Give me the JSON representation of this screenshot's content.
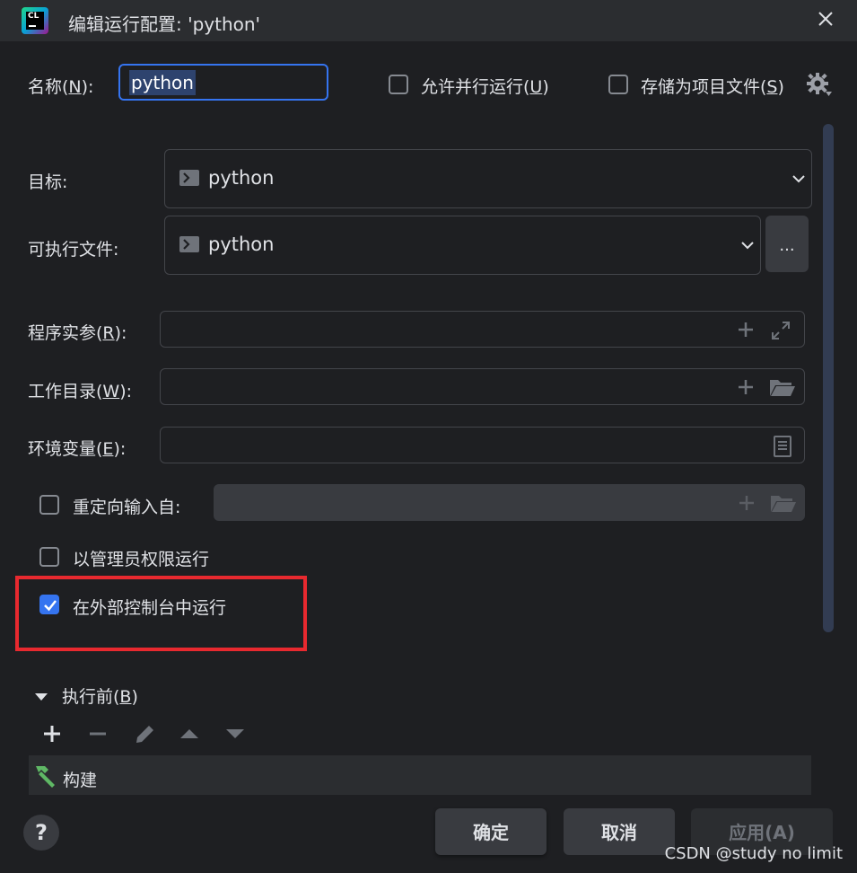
{
  "window": {
    "app_icon_text": "CL",
    "title": "编辑运行配置: 'python'"
  },
  "name_row": {
    "label": "名称(",
    "mnemonic": "N",
    "label_end": "):",
    "value": "python",
    "allow_parallel": {
      "label": "允许并行运行(",
      "mnemonic": "U",
      "label_end": ")",
      "checked": false
    },
    "store_as_project_file": {
      "label": "存储为项目文件(",
      "mnemonic": "S",
      "label_end": ")",
      "checked": false
    }
  },
  "target": {
    "label": "目标:",
    "value": "python"
  },
  "executable": {
    "label": "可执行文件:",
    "value": "python",
    "browse_label": "..."
  },
  "program_args": {
    "label": "程序实参(",
    "mnemonic": "R",
    "label_end": "):",
    "value": ""
  },
  "working_dir": {
    "label": "工作目录(",
    "mnemonic": "W",
    "label_end": "):",
    "value": ""
  },
  "env_vars": {
    "label": "环境变量(",
    "mnemonic": "E",
    "label_end": "):",
    "value": ""
  },
  "redirect_input": {
    "label": "重定向输入自:",
    "checked": false,
    "value": ""
  },
  "run_as_admin": {
    "label": "以管理员权限运行",
    "checked": false
  },
  "run_in_external_console": {
    "label": "在外部控制台中运行",
    "checked": true
  },
  "before_launch": {
    "label": "执行前(",
    "mnemonic": "B",
    "label_end": ")",
    "tasks": [
      "构建"
    ]
  },
  "buttons": {
    "help": "?",
    "ok": "确定",
    "cancel": "取消",
    "apply": "应用(A)"
  },
  "watermark": "CSDN @study no limit",
  "colors": {
    "accent": "#3574f0",
    "background": "#1e1f22",
    "panel": "#2b2d30",
    "highlight_box": "#e8292f",
    "hammer": "#5fb865"
  }
}
